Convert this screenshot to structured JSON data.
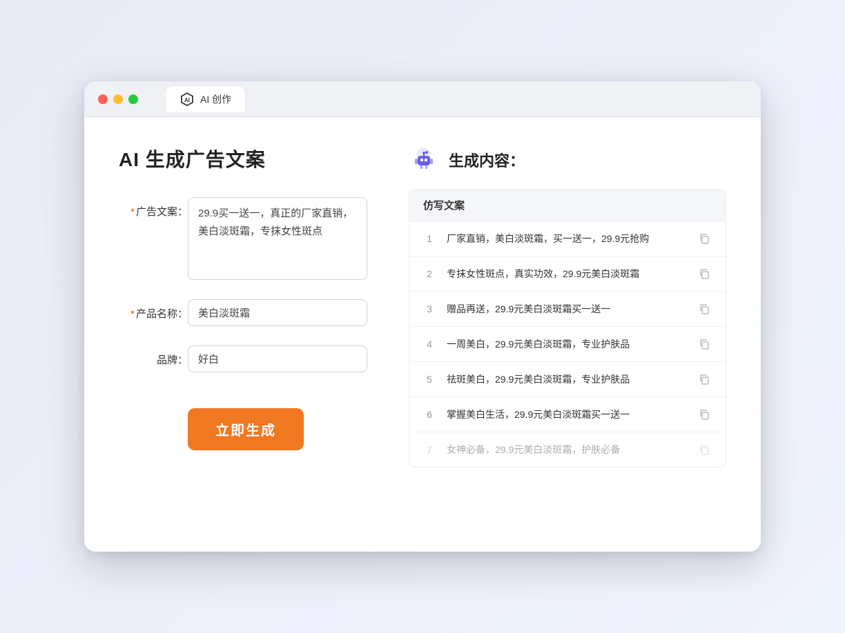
{
  "window": {
    "tab_label": "AI 创作",
    "traffic_lights": [
      "red",
      "yellow",
      "green"
    ]
  },
  "left_panel": {
    "title": "AI 生成广告文案",
    "form": {
      "ad_copy_label": "广告文案：",
      "ad_copy_required": "*",
      "ad_copy_value": "29.9买一送一，真正的厂家直销，美白淡斑霜，专抹女性斑点",
      "product_label": "产品名称：",
      "product_required": "*",
      "product_value": "美白淡斑霜",
      "brand_label": "品牌：",
      "brand_value": "好白",
      "generate_btn": "立即生成"
    }
  },
  "right_panel": {
    "title": "生成内容：",
    "table_header": "仿写文案",
    "results": [
      {
        "num": "1",
        "text": "厂家直销，美白淡斑霜，买一送一，29.9元抢购",
        "faded": false
      },
      {
        "num": "2",
        "text": "专抹女性斑点，真实功效，29.9元美白淡斑霜",
        "faded": false
      },
      {
        "num": "3",
        "text": "赠品再送，29.9元美白淡斑霜买一送一",
        "faded": false
      },
      {
        "num": "4",
        "text": "一周美白，29.9元美白淡斑霜，专业护肤品",
        "faded": false
      },
      {
        "num": "5",
        "text": "祛斑美白，29.9元美白淡斑霜，专业护肤品",
        "faded": false
      },
      {
        "num": "6",
        "text": "掌握美白生活，29.9元美白淡斑霜买一送一",
        "faded": false
      },
      {
        "num": "7",
        "text": "女神必备，29.9元美白淡斑霜，护肤必备",
        "faded": true
      }
    ]
  }
}
